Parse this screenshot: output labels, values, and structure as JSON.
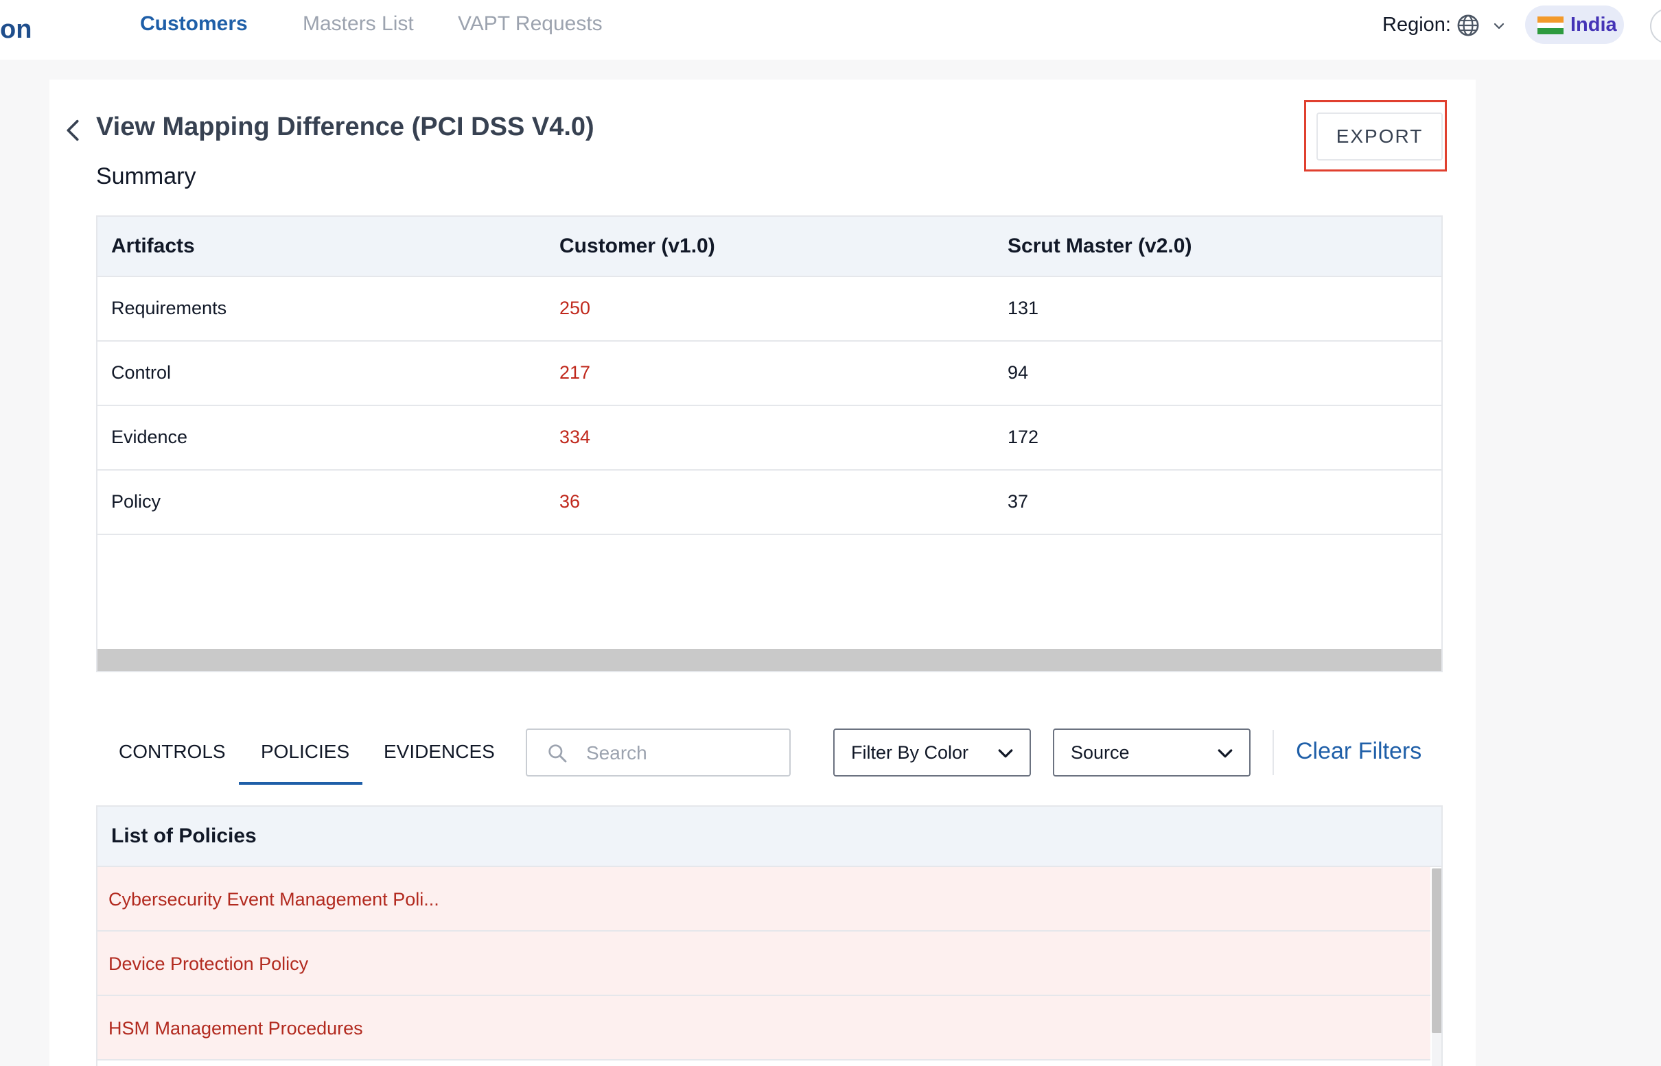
{
  "nav": {
    "brand_fragment": "on",
    "links": [
      {
        "label": "Customers",
        "active": true
      },
      {
        "label": "Masters List",
        "active": false
      },
      {
        "label": "VAPT Requests",
        "active": false
      }
    ],
    "region_label": "Region:",
    "region_value": "India"
  },
  "page": {
    "title": "View Mapping Difference (PCI DSS V4.0)",
    "summary_title": "Summary",
    "export_label": "EXPORT"
  },
  "summary_table": {
    "headers": [
      "Artifacts",
      "Customer (v1.0)",
      "Scrut Master (v2.0)"
    ],
    "rows": [
      {
        "artifact": "Requirements",
        "customer": "250",
        "master": "131"
      },
      {
        "artifact": "Control",
        "customer": "217",
        "master": "94"
      },
      {
        "artifact": "Evidence",
        "customer": "334",
        "master": "172"
      },
      {
        "artifact": "Policy",
        "customer": "36",
        "master": "37"
      }
    ]
  },
  "tabs": [
    {
      "label": "CONTROLS",
      "active": false
    },
    {
      "label": "POLICIES",
      "active": true
    },
    {
      "label": "EVIDENCES",
      "active": false
    }
  ],
  "filters": {
    "search_placeholder": "Search",
    "color_filter": "Filter By Color",
    "source_filter": "Source",
    "clear_label": "Clear Filters"
  },
  "policies": {
    "title": "List of Policies",
    "items": [
      "Cybersecurity Event Management Poli...",
      "Device Protection Policy",
      "HSM Management Procedures"
    ]
  },
  "colors": {
    "primary": "#1f5fa8",
    "accent_red": "#c0281c",
    "highlight_border": "#e0402f",
    "row_diff_bg": "#fdf0ef",
    "header_bg": "#f0f4f9"
  }
}
